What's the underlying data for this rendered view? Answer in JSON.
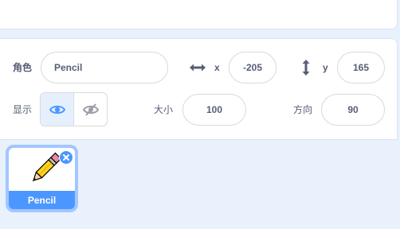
{
  "sprite_info": {
    "sprite_label": "角色",
    "sprite_name": "Pencil",
    "x_label": "x",
    "x_value": "-205",
    "y_label": "y",
    "y_value": "165",
    "show_label": "显示",
    "size_label": "大小",
    "size_value": "100",
    "direction_label": "方向",
    "direction_value": "90"
  },
  "sprite_list": {
    "items": [
      {
        "name": "Pencil",
        "selected": true
      }
    ]
  },
  "colors": {
    "accent": "#4c97ff",
    "selected_border": "#a3c6ff",
    "panel_bg": "#e9f1fc",
    "text": "#575e75"
  },
  "icons": {
    "x_axis": "horizontal-arrows-icon",
    "y_axis": "vertical-arrows-icon",
    "show": "eye-icon",
    "hide": "eye-slash-icon",
    "delete": "close-icon",
    "sprite": "pencil-icon"
  }
}
